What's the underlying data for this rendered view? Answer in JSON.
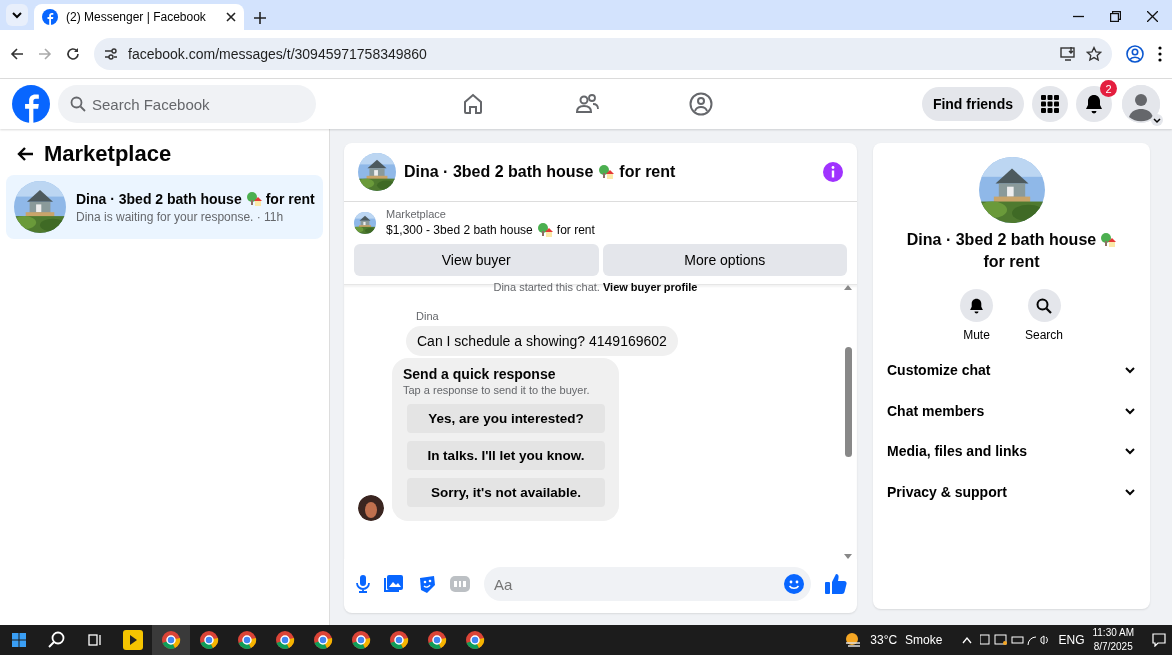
{
  "browser": {
    "tabs": [
      {
        "title": "(2) Messenger | Facebook",
        "selected": true
      }
    ],
    "url": "facebook.com/messages/t/30945971758349860"
  },
  "header": {
    "search_placeholder": "Search Facebook",
    "find_friends": "Find friends",
    "notification_count": "2"
  },
  "sidebar": {
    "title": "Marketplace",
    "chats": [
      {
        "name": "Dina · 3bed 2 bath house",
        "suffix": "for rent",
        "preview": "Dina is waiting for your response. · 11h",
        "selected": true
      }
    ]
  },
  "chat": {
    "title": "Dina · 3bed 2 bath house",
    "title_suffix": "for rent",
    "listing": {
      "label": "Marketplace",
      "text": "$1,300 - 3bed 2 bath house",
      "suffix": "for rent"
    },
    "buttons": [
      "View buyer",
      "More options"
    ],
    "system_note": {
      "text": "Dina started this chat.",
      "link": "View buyer profile"
    },
    "messages": [
      {
        "sender": "Dina",
        "text": "Can I schedule a showing? 4149169602"
      }
    ],
    "quick": {
      "title": "Send a quick response",
      "subtitle": "Tap a response to send it to the buyer.",
      "options": [
        "Yes, are you interested?",
        "In talks. I'll let you know.",
        "Sorry, it's not available."
      ]
    },
    "composer": {
      "placeholder": "Aa"
    }
  },
  "details": {
    "title": "Dina · 3bed 2 bath house",
    "title_suffix": "for rent",
    "actions": [
      {
        "label": "Mute",
        "kind": "mute"
      },
      {
        "label": "Search",
        "kind": "search"
      }
    ],
    "sections": [
      "Customize chat",
      "Chat members",
      "Media, files and links",
      "Privacy & support"
    ]
  },
  "taskbar": {
    "apps": [
      {
        "kind": "player",
        "selected": false
      },
      {
        "kind": "browser",
        "selected": true
      },
      {
        "kind": "browser",
        "selected": false
      },
      {
        "kind": "browser",
        "selected": false
      },
      {
        "kind": "browser",
        "selected": false
      },
      {
        "kind": "browser",
        "selected": false
      },
      {
        "kind": "browser",
        "selected": false
      },
      {
        "kind": "browser",
        "selected": false
      },
      {
        "kind": "browser",
        "selected": false
      },
      {
        "kind": "browser",
        "selected": false
      }
    ],
    "temperature": "33°C",
    "weather": "Smoke",
    "language": "ENG",
    "time": "11:30 AM",
    "date": "8/7/2025"
  }
}
